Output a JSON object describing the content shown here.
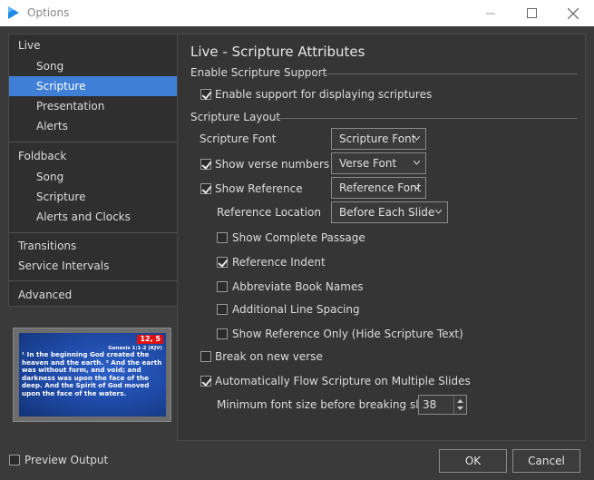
{
  "window": {
    "title": "Options",
    "app_icon": "play-logo-icon",
    "accent_color": "#1e88e5"
  },
  "nav": {
    "groups": [
      {
        "label": "Live",
        "items": [
          "Song",
          "Scripture",
          "Presentation",
          "Alerts"
        ]
      },
      {
        "label": "Foldback",
        "items": [
          "Song",
          "Scripture",
          "Alerts and Clocks"
        ]
      },
      {
        "label": "Transitions",
        "items": []
      },
      {
        "label": "Service Intervals",
        "items": []
      },
      {
        "label": "Advanced",
        "items": []
      }
    ],
    "selected": "Scripture",
    "selected_color": "#3f7fd6"
  },
  "preview": {
    "badge": "12, 5",
    "reference": "Genesis 1:1-2 (KJV)",
    "text": "¹ In the beginning God created the heaven and the earth. ² And the earth was without form, and void; and darkness was upon the face of the deep. And the Spirit of God moved upon the face of the waters."
  },
  "preview_output": {
    "label": "Preview Output",
    "checked": false
  },
  "panel": {
    "title": "Live - Scripture Attributes",
    "section_enable": "Enable Scripture Support",
    "enable_support": {
      "label": "Enable support for displaying scriptures",
      "checked": true
    },
    "section_layout": "Scripture Layout",
    "scripture_font": {
      "label": "Scripture Font",
      "button": "Scripture Font"
    },
    "show_verse_numbers": {
      "label": "Show verse numbers",
      "checked": true,
      "button": "Verse Font"
    },
    "show_reference": {
      "label": "Show Reference",
      "checked": true,
      "button": "Reference Font"
    },
    "reference_location": {
      "label": "Reference Location",
      "value": "Before Each Slide"
    },
    "show_complete_passage": {
      "label": "Show Complete Passage",
      "checked": false
    },
    "reference_indent": {
      "label": "Reference Indent",
      "checked": true
    },
    "abbreviate_book_names": {
      "label": "Abbreviate Book Names",
      "checked": false
    },
    "additional_line_spacing": {
      "label": "Additional Line Spacing",
      "checked": false
    },
    "show_reference_only": {
      "label": "Show Reference Only (Hide Scripture Text)",
      "checked": false
    },
    "break_on_new_verse": {
      "label": "Break on new verse",
      "checked": false
    },
    "auto_flow": {
      "label": "Automatically Flow Scripture on Multiple Slides",
      "checked": true
    },
    "min_font_size": {
      "label": "Minimum font size before breaking slide",
      "value": "38"
    }
  },
  "buttons": {
    "ok": "OK",
    "cancel": "Cancel"
  }
}
